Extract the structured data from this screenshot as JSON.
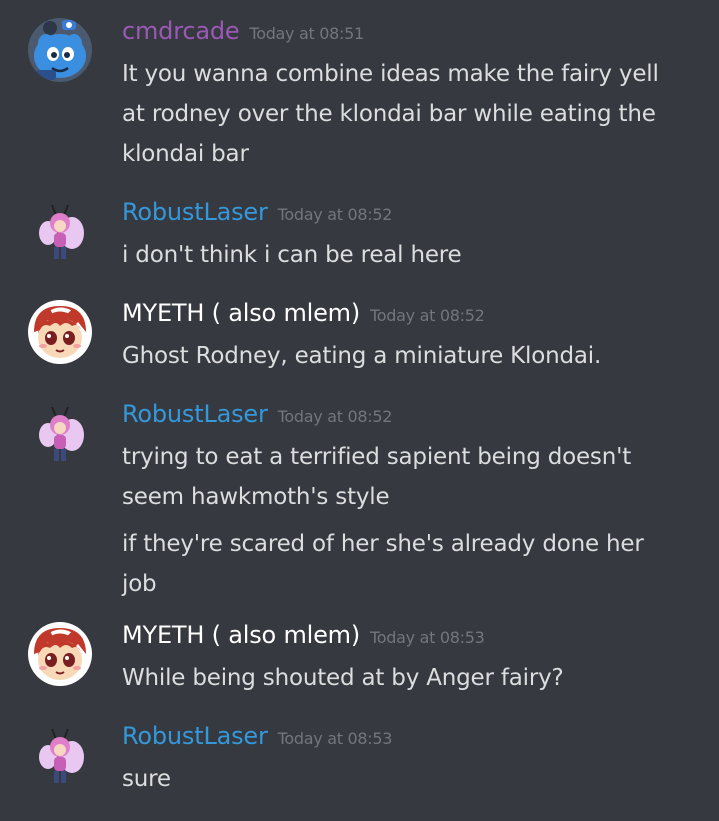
{
  "colors": {
    "background": "#36393f",
    "message_text": "#dcddde",
    "timestamp": "#72767d",
    "cmdrcade": "#9b59b6",
    "robustlaser": "#3498db",
    "myeth": "#ffffff"
  },
  "messages": [
    {
      "author": "cmdrcade",
      "timestamp": "Today at 08:51",
      "avatar_icon": "blue-creature-avatar",
      "lines": [
        "It you wanna combine ideas make the fairy yell",
        "at rodney over the klondai bar while eating the",
        "klondai bar"
      ]
    },
    {
      "author": "RobustLaser",
      "timestamp": "Today at 08:52",
      "avatar_icon": "pink-fairy-avatar",
      "lines": [
        "i don't think i can be real here"
      ]
    },
    {
      "author": "MYETH ( also mlem)",
      "timestamp": "Today at 08:52",
      "avatar_icon": "red-haired-boy-avatar",
      "lines": [
        "Ghost Rodney, eating a miniature Klondai."
      ]
    },
    {
      "author": "RobustLaser",
      "timestamp": "Today at 08:52",
      "avatar_icon": "pink-fairy-avatar",
      "lines": [
        "trying to eat a terrified sapient being doesn't",
        "seem hawkmoth's style",
        "if they're scared of her she's already done her",
        "job"
      ]
    },
    {
      "author": "MYETH ( also mlem)",
      "timestamp": "Today at 08:53",
      "avatar_icon": "red-haired-boy-avatar",
      "lines": [
        "While being shouted at by Anger fairy?"
      ]
    },
    {
      "author": "RobustLaser",
      "timestamp": "Today at 08:53",
      "avatar_icon": "pink-fairy-avatar",
      "lines": [
        "sure"
      ]
    }
  ]
}
